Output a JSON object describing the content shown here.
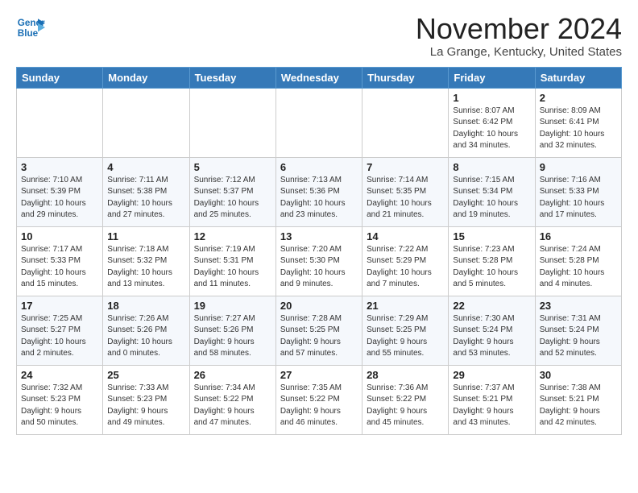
{
  "header": {
    "logo_line1": "General",
    "logo_line2": "Blue",
    "month": "November 2024",
    "location": "La Grange, Kentucky, United States"
  },
  "weekdays": [
    "Sunday",
    "Monday",
    "Tuesday",
    "Wednesday",
    "Thursday",
    "Friday",
    "Saturday"
  ],
  "weeks": [
    [
      {
        "day": "",
        "info": ""
      },
      {
        "day": "",
        "info": ""
      },
      {
        "day": "",
        "info": ""
      },
      {
        "day": "",
        "info": ""
      },
      {
        "day": "",
        "info": ""
      },
      {
        "day": "1",
        "info": "Sunrise: 8:07 AM\nSunset: 6:42 PM\nDaylight: 10 hours\nand 34 minutes."
      },
      {
        "day": "2",
        "info": "Sunrise: 8:09 AM\nSunset: 6:41 PM\nDaylight: 10 hours\nand 32 minutes."
      }
    ],
    [
      {
        "day": "3",
        "info": "Sunrise: 7:10 AM\nSunset: 5:39 PM\nDaylight: 10 hours\nand 29 minutes."
      },
      {
        "day": "4",
        "info": "Sunrise: 7:11 AM\nSunset: 5:38 PM\nDaylight: 10 hours\nand 27 minutes."
      },
      {
        "day": "5",
        "info": "Sunrise: 7:12 AM\nSunset: 5:37 PM\nDaylight: 10 hours\nand 25 minutes."
      },
      {
        "day": "6",
        "info": "Sunrise: 7:13 AM\nSunset: 5:36 PM\nDaylight: 10 hours\nand 23 minutes."
      },
      {
        "day": "7",
        "info": "Sunrise: 7:14 AM\nSunset: 5:35 PM\nDaylight: 10 hours\nand 21 minutes."
      },
      {
        "day": "8",
        "info": "Sunrise: 7:15 AM\nSunset: 5:34 PM\nDaylight: 10 hours\nand 19 minutes."
      },
      {
        "day": "9",
        "info": "Sunrise: 7:16 AM\nSunset: 5:33 PM\nDaylight: 10 hours\nand 17 minutes."
      }
    ],
    [
      {
        "day": "10",
        "info": "Sunrise: 7:17 AM\nSunset: 5:33 PM\nDaylight: 10 hours\nand 15 minutes."
      },
      {
        "day": "11",
        "info": "Sunrise: 7:18 AM\nSunset: 5:32 PM\nDaylight: 10 hours\nand 13 minutes."
      },
      {
        "day": "12",
        "info": "Sunrise: 7:19 AM\nSunset: 5:31 PM\nDaylight: 10 hours\nand 11 minutes."
      },
      {
        "day": "13",
        "info": "Sunrise: 7:20 AM\nSunset: 5:30 PM\nDaylight: 10 hours\nand 9 minutes."
      },
      {
        "day": "14",
        "info": "Sunrise: 7:22 AM\nSunset: 5:29 PM\nDaylight: 10 hours\nand 7 minutes."
      },
      {
        "day": "15",
        "info": "Sunrise: 7:23 AM\nSunset: 5:28 PM\nDaylight: 10 hours\nand 5 minutes."
      },
      {
        "day": "16",
        "info": "Sunrise: 7:24 AM\nSunset: 5:28 PM\nDaylight: 10 hours\nand 4 minutes."
      }
    ],
    [
      {
        "day": "17",
        "info": "Sunrise: 7:25 AM\nSunset: 5:27 PM\nDaylight: 10 hours\nand 2 minutes."
      },
      {
        "day": "18",
        "info": "Sunrise: 7:26 AM\nSunset: 5:26 PM\nDaylight: 10 hours\nand 0 minutes."
      },
      {
        "day": "19",
        "info": "Sunrise: 7:27 AM\nSunset: 5:26 PM\nDaylight: 9 hours\nand 58 minutes."
      },
      {
        "day": "20",
        "info": "Sunrise: 7:28 AM\nSunset: 5:25 PM\nDaylight: 9 hours\nand 57 minutes."
      },
      {
        "day": "21",
        "info": "Sunrise: 7:29 AM\nSunset: 5:25 PM\nDaylight: 9 hours\nand 55 minutes."
      },
      {
        "day": "22",
        "info": "Sunrise: 7:30 AM\nSunset: 5:24 PM\nDaylight: 9 hours\nand 53 minutes."
      },
      {
        "day": "23",
        "info": "Sunrise: 7:31 AM\nSunset: 5:24 PM\nDaylight: 9 hours\nand 52 minutes."
      }
    ],
    [
      {
        "day": "24",
        "info": "Sunrise: 7:32 AM\nSunset: 5:23 PM\nDaylight: 9 hours\nand 50 minutes."
      },
      {
        "day": "25",
        "info": "Sunrise: 7:33 AM\nSunset: 5:23 PM\nDaylight: 9 hours\nand 49 minutes."
      },
      {
        "day": "26",
        "info": "Sunrise: 7:34 AM\nSunset: 5:22 PM\nDaylight: 9 hours\nand 47 minutes."
      },
      {
        "day": "27",
        "info": "Sunrise: 7:35 AM\nSunset: 5:22 PM\nDaylight: 9 hours\nand 46 minutes."
      },
      {
        "day": "28",
        "info": "Sunrise: 7:36 AM\nSunset: 5:22 PM\nDaylight: 9 hours\nand 45 minutes."
      },
      {
        "day": "29",
        "info": "Sunrise: 7:37 AM\nSunset: 5:21 PM\nDaylight: 9 hours\nand 43 minutes."
      },
      {
        "day": "30",
        "info": "Sunrise: 7:38 AM\nSunset: 5:21 PM\nDaylight: 9 hours\nand 42 minutes."
      }
    ]
  ]
}
